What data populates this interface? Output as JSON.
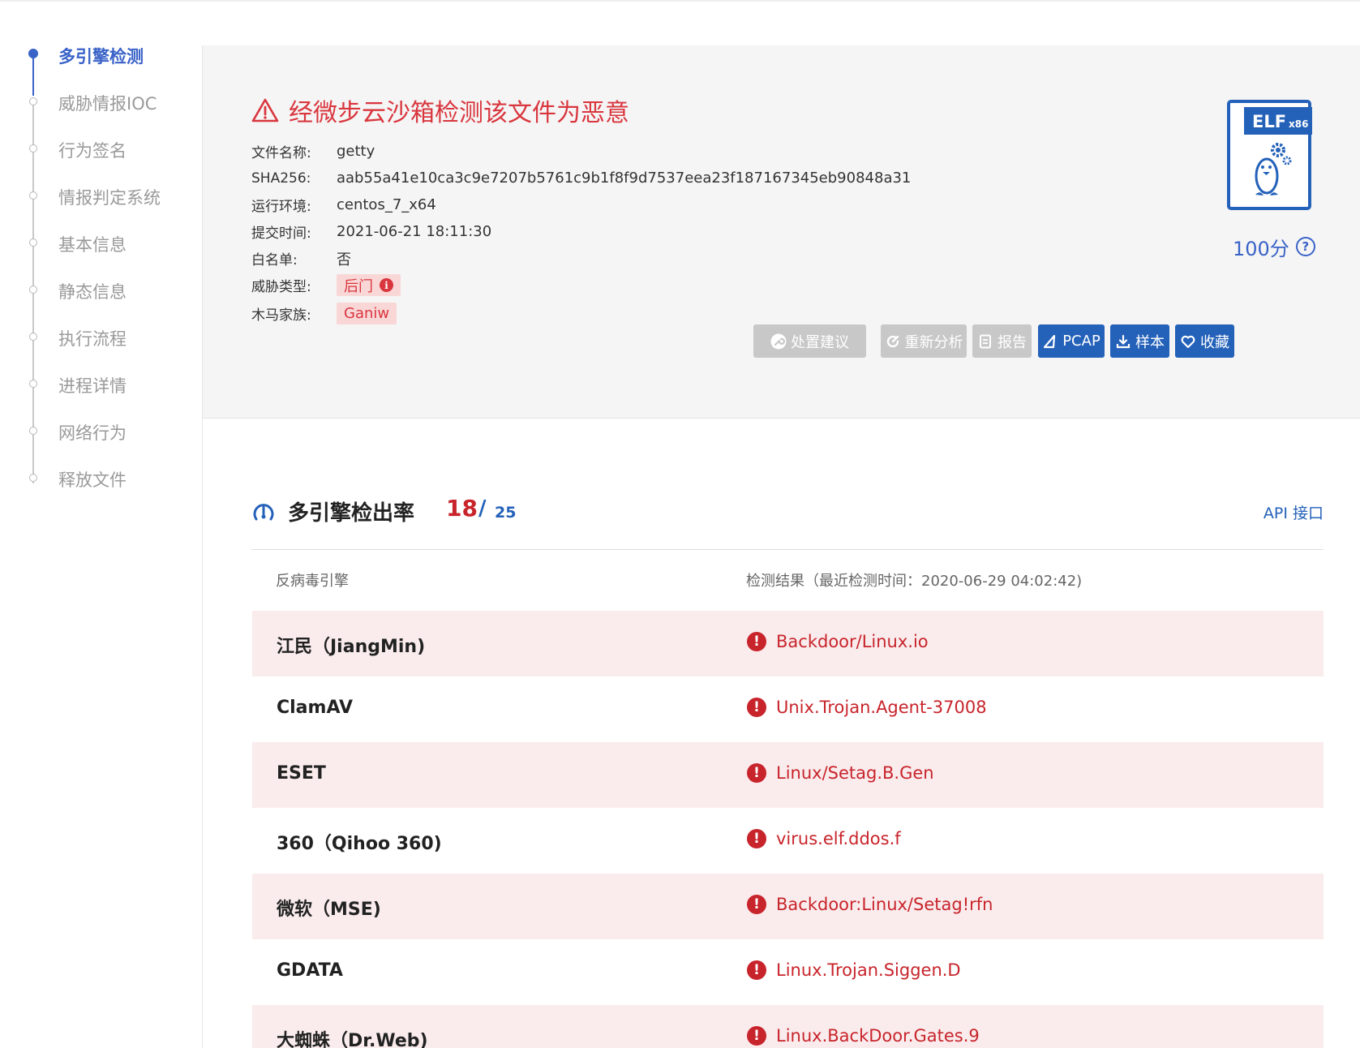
{
  "nav": {
    "items": [
      {
        "label": "多引擎检测",
        "active": true
      },
      {
        "label": "威胁情报IOC",
        "active": false
      },
      {
        "label": "行为签名",
        "active": false
      },
      {
        "label": "情报判定系统",
        "active": false
      },
      {
        "label": "基本信息",
        "active": false
      },
      {
        "label": "静态信息",
        "active": false
      },
      {
        "label": "执行流程",
        "active": false
      },
      {
        "label": "进程详情",
        "active": false
      },
      {
        "label": "网络行为",
        "active": false
      },
      {
        "label": "释放文件",
        "active": false
      }
    ]
  },
  "summary": {
    "verdict": "经微步云沙箱检测该文件为恶意",
    "fields": {
      "filename_key": "文件名称:",
      "filename": "getty",
      "sha256_key": "SHA256:",
      "sha256": "aab55a41e10ca3c9e7207b5761c9b1f8f9d7537eea23f187167345eb90848a31",
      "env_key": "运行环境:",
      "env": "centos_7_x64",
      "time_key": "提交时间:",
      "time": "2021-06-21 18:11:30",
      "whitelist_key": "白名单:",
      "whitelist": "否",
      "threat_key": "威胁类型:",
      "threat": "后门",
      "family_key": "木马家族:",
      "family": "Ganiw"
    },
    "file_icon": {
      "type": "ELF",
      "arch": "x86",
      "icon": "linux-penguin-icon"
    },
    "score": "100分",
    "score_help": "?",
    "actions": {
      "advice": "处置建议",
      "reanalyze": "重新分析",
      "report": "报告",
      "pcap": "PCAP",
      "sample": "样本",
      "favorite": "收藏"
    }
  },
  "detection": {
    "title": "多引擎检出率",
    "detected": "18",
    "separator": "/",
    "total": "25",
    "api_link": "API 接口",
    "col_engine": "反病毒引擎",
    "col_result": "检测结果（最近检测时间：2020-06-29 04:02:42)",
    "rows": [
      {
        "engine": "江民（JiangMin)",
        "result": "Backdoor/Linux.io"
      },
      {
        "engine": "ClamAV",
        "result": "Unix.Trojan.Agent-37008"
      },
      {
        "engine": "ESET",
        "result": "Linux/Setag.B.Gen"
      },
      {
        "engine": "360（Qihoo 360)",
        "result": "virus.elf.ddos.f"
      },
      {
        "engine": "微软（MSE)",
        "result": "Backdoor:Linux/Setag!rfn"
      },
      {
        "engine": "GDATA",
        "result": "Linux.Trojan.Siggen.D"
      },
      {
        "engine": "大蜘蛛（Dr.Web)",
        "result": "Linux.BackDoor.Gates.9"
      }
    ]
  },
  "colors": {
    "accent": "#3a63c8",
    "button_blue": "#2461b9",
    "danger": "#c8242b",
    "danger_bg": "#faeced",
    "button_gray": "#c8c8c8"
  }
}
